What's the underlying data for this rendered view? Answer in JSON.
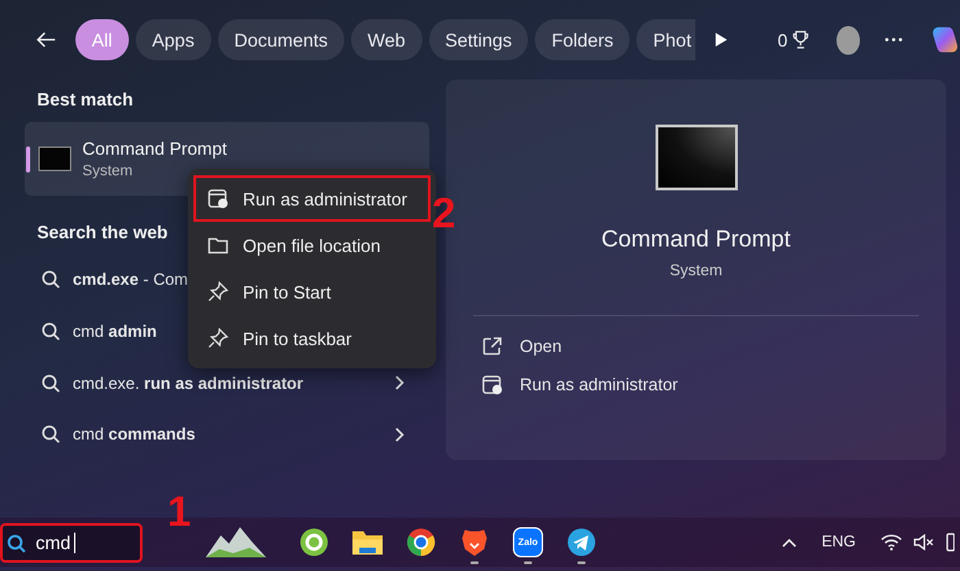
{
  "filters": [
    {
      "label": "All",
      "selected": true
    },
    {
      "label": "Apps",
      "selected": false
    },
    {
      "label": "Documents",
      "selected": false
    },
    {
      "label": "Web",
      "selected": false
    },
    {
      "label": "Settings",
      "selected": false
    },
    {
      "label": "Folders",
      "selected": false
    },
    {
      "label": "Phot",
      "selected": false
    }
  ],
  "top_actions": {
    "points": "0"
  },
  "best_match": {
    "heading": "Best match",
    "title": "Command Prompt",
    "subtitle": "System",
    "selected": true
  },
  "web_search": {
    "heading": "Search the web",
    "results": [
      {
        "text": "**cmd.exe** - Com"
      },
      {
        "text": "cmd **admin**"
      },
      {
        "text": "cmd.exe. **run as administrator**",
        "has_arrow": true
      },
      {
        "text": "cmd **commands**",
        "has_arrow": true
      }
    ]
  },
  "context_menu": {
    "items": [
      {
        "label": "Run as administrator",
        "kind": "admin",
        "highlighted": true
      },
      {
        "label": "Open file location",
        "kind": "folder",
        "highlighted": false
      },
      {
        "label": "Pin to Start",
        "kind": "pin",
        "highlighted": false
      },
      {
        "label": "Pin to taskbar",
        "kind": "pin",
        "highlighted": false
      }
    ]
  },
  "preview": {
    "title": "Command Prompt",
    "subtitle": "System",
    "actions": [
      {
        "label": "Open",
        "kind": "open"
      },
      {
        "label": "Run as administrator",
        "kind": "admin"
      }
    ]
  },
  "taskbar": {
    "search": {
      "value": "cmd",
      "highlighted": true
    },
    "apps": [
      {
        "kind": "browser-green",
        "running": false
      },
      {
        "kind": "folder",
        "running": false
      },
      {
        "kind": "browser-round",
        "running": false
      },
      {
        "kind": "lion",
        "running": true
      },
      {
        "kind": "chat",
        "label": "Zalo",
        "running": true
      },
      {
        "kind": "paper-plane",
        "running": true
      }
    ],
    "language": "ENG"
  },
  "annotations": [
    {
      "number": "1"
    },
    {
      "number": "2"
    }
  ]
}
